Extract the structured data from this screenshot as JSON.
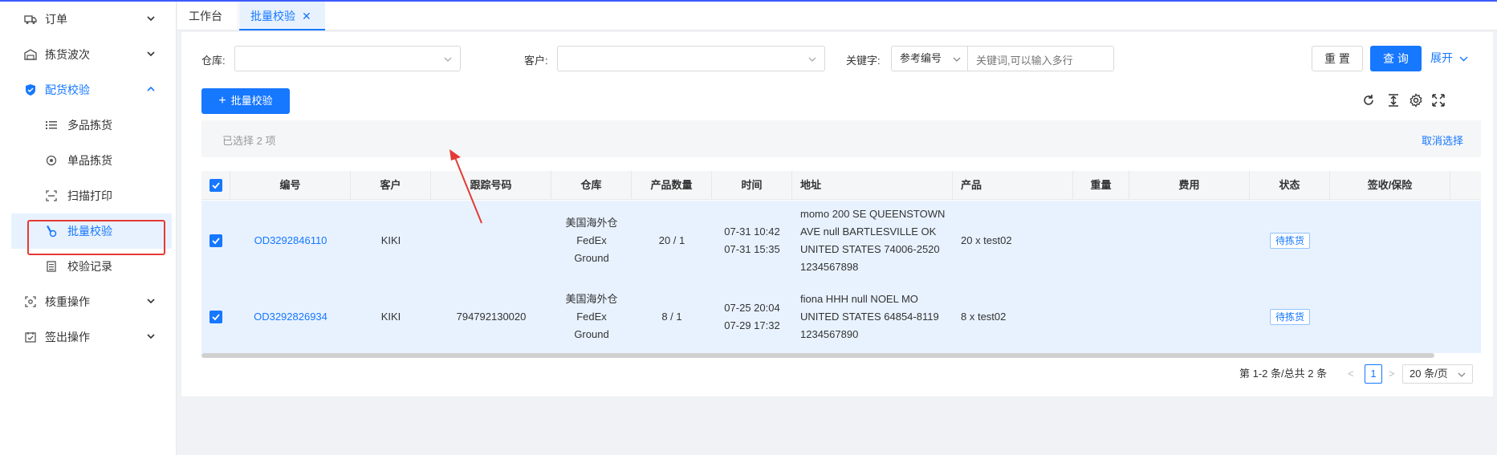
{
  "sidebar": {
    "items": [
      {
        "label": "订单",
        "icon": "truck-icon",
        "expanded": false
      },
      {
        "label": "拣货波次",
        "icon": "warehouse-icon",
        "expanded": false
      },
      {
        "label": "配货校验",
        "icon": "shield-icon",
        "expanded": true,
        "children": [
          {
            "label": "多品拣货",
            "icon": "list-icon"
          },
          {
            "label": "单品拣货",
            "icon": "target-icon"
          },
          {
            "label": "扫描打印",
            "icon": "scan-icon"
          },
          {
            "label": "批量校验",
            "icon": "pick-icon",
            "active": true
          },
          {
            "label": "校验记录",
            "icon": "record-icon"
          }
        ]
      },
      {
        "label": "核重操作",
        "icon": "scale-icon",
        "expanded": false
      },
      {
        "label": "签出操作",
        "icon": "checkout-icon",
        "expanded": false
      }
    ]
  },
  "tabs": [
    {
      "label": "工作台",
      "active": false
    },
    {
      "label": "批量校验",
      "active": true,
      "close": "✕"
    }
  ],
  "filters": {
    "warehouse_label": "仓库:",
    "warehouse_value": "",
    "customer_label": "客户:",
    "customer_value": "",
    "keyword_label": "关键字:",
    "keyword_type": "参考编号",
    "keyword_placeholder": "关键词,可以输入多行"
  },
  "buttons": {
    "reset": "重 置",
    "query": "查 询",
    "expand": "展开",
    "batch_verify": "批量校验"
  },
  "selection": {
    "info": "已选择 2 项",
    "cancel": "取消选择"
  },
  "table": {
    "columns": [
      "编号",
      "客户",
      "跟踪号码",
      "仓库",
      "产品数量",
      "时间",
      "地址",
      "产品",
      "重量",
      "费用",
      "状态",
      "签收/保险"
    ],
    "rows": [
      {
        "id": "OD3292846110",
        "customer": "KIKI",
        "tracking": "",
        "warehouse": [
          "美国海外仓",
          "FedEx",
          "Ground"
        ],
        "qty": "20 / 1",
        "times": [
          "07-31 10:42",
          "07-31 15:35"
        ],
        "address": [
          "momo 200 SE QUEENSTOWN",
          "AVE null BARTLESVILLE OK",
          "UNITED STATES 74006-2520",
          "1234567898"
        ],
        "product": "20 x test02",
        "weight": "",
        "fee": "",
        "status": "待拣货",
        "sign": ""
      },
      {
        "id": "OD3292826934",
        "customer": "KIKI",
        "tracking": "794792130020",
        "warehouse": [
          "美国海外仓",
          "FedEx",
          "Ground"
        ],
        "qty": "8 / 1",
        "times": [
          "07-25 20:04",
          "07-29 17:32"
        ],
        "address": [
          "fiona HHH null NOEL MO",
          "UNITED STATES 64854-8119",
          "1234567890"
        ],
        "product": "8 x test02",
        "weight": "",
        "fee": "",
        "status": "待拣货",
        "sign": ""
      }
    ]
  },
  "pagination": {
    "info": "第 1-2 条/总共 2 条",
    "prev": "<",
    "current": "1",
    "next": ">",
    "page_size": "20 条/页"
  },
  "colors": {
    "primary": "#1677ff",
    "highlight_box": "#e53935",
    "row_selected": "#e8f2ff"
  }
}
